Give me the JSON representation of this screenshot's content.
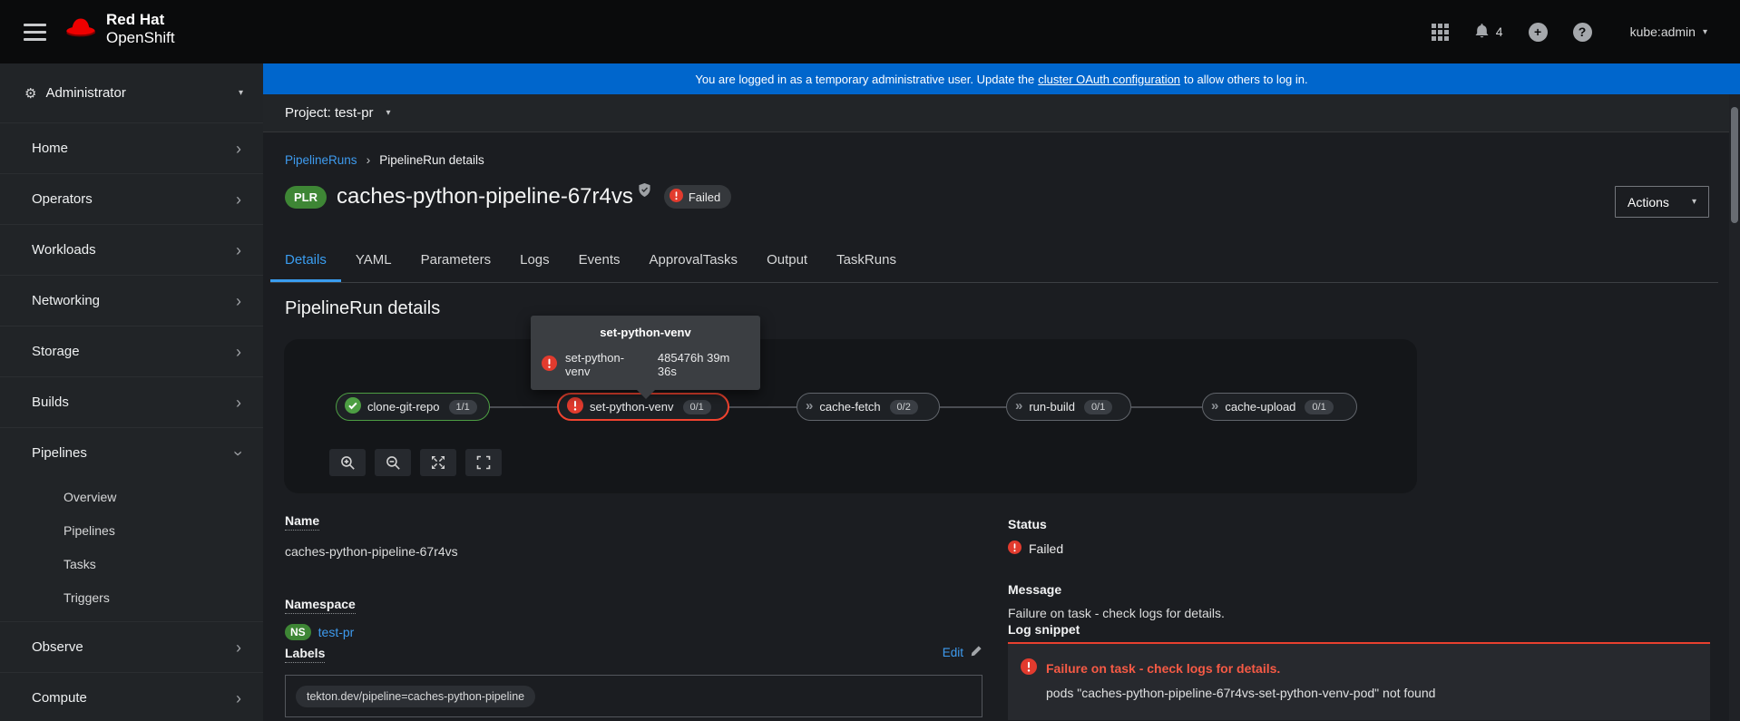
{
  "masthead": {
    "brand_top": "Red Hat",
    "brand_bottom": "OpenShift",
    "notification_count": "4",
    "username": "kube:admin"
  },
  "banner": {
    "pre": "You are logged in as a temporary administrative user. Update the",
    "link_text": "cluster OAuth configuration",
    "post": "to allow others to log in."
  },
  "project_bar": {
    "label": "Project: test-pr"
  },
  "sidebar": {
    "perspective": "Administrator",
    "items": [
      {
        "label": "Home"
      },
      {
        "label": "Operators"
      },
      {
        "label": "Workloads"
      },
      {
        "label": "Networking"
      },
      {
        "label": "Storage"
      },
      {
        "label": "Builds"
      },
      {
        "label": "Pipelines"
      },
      {
        "label": "Observe"
      },
      {
        "label": "Compute"
      }
    ],
    "pipelines_sub": [
      {
        "label": "Overview"
      },
      {
        "label": "Pipelines"
      },
      {
        "label": "Tasks"
      },
      {
        "label": "Triggers"
      }
    ]
  },
  "breadcrumb": {
    "parent": "PipelineRuns",
    "current": "PipelineRun details"
  },
  "header": {
    "resource_badge": "PLR",
    "title": "caches-python-pipeline-67r4vs",
    "status_badge": "Failed",
    "actions_label": "Actions"
  },
  "tabs": {
    "active": "Details",
    "items": [
      {
        "label": "Details"
      },
      {
        "label": "YAML"
      },
      {
        "label": "Parameters"
      },
      {
        "label": "Logs"
      },
      {
        "label": "Events"
      },
      {
        "label": "ApprovalTasks"
      },
      {
        "label": "Output"
      },
      {
        "label": "TaskRuns"
      }
    ]
  },
  "section": {
    "heading": "PipelineRun details"
  },
  "tooltip": {
    "title": "set-python-venv",
    "task_name": "set-python-venv",
    "duration": "485476h 39m 36s"
  },
  "graph": {
    "nodes": [
      {
        "name": "clone-git-repo",
        "count": "1/1",
        "state": "success"
      },
      {
        "name": "set-python-venv",
        "count": "0/1",
        "state": "failed"
      },
      {
        "name": "cache-fetch",
        "count": "0/2",
        "state": "pending"
      },
      {
        "name": "run-build",
        "count": "0/1",
        "state": "pending"
      },
      {
        "name": "cache-upload",
        "count": "0/1",
        "state": "pending"
      }
    ]
  },
  "details": {
    "name_label": "Name",
    "name_value": "caches-python-pipeline-67r4vs",
    "namespace_label": "Namespace",
    "namespace_badge": "NS",
    "namespace_value": "test-pr",
    "labels_label": "Labels",
    "edit_label": "Edit",
    "label_chip": "tekton.dev/pipeline=caches-python-pipeline"
  },
  "status_panel": {
    "status_label": "Status",
    "status_value": "Failed",
    "message_label": "Message",
    "message_value": "Failure on task - check logs for details.",
    "log_label": "Log snippet",
    "log_error": "Failure on task - check logs for details.",
    "log_detail": "pods \"caches-python-pipeline-67r4vs-set-python-venv-pod\" not found"
  },
  "icons": {
    "gear": "⚙",
    "caret_down": "▾",
    "chevron_right": "›",
    "double_chevron": "»",
    "breadcrumb_separator": "›",
    "plus": "+",
    "question": "?"
  },
  "colors": {
    "banner_blue": "#0066cc",
    "link_blue": "#3e9bef",
    "success_green": "#4d9e43",
    "danger_red": "#e8402f",
    "resource_green": "#3e8635"
  }
}
